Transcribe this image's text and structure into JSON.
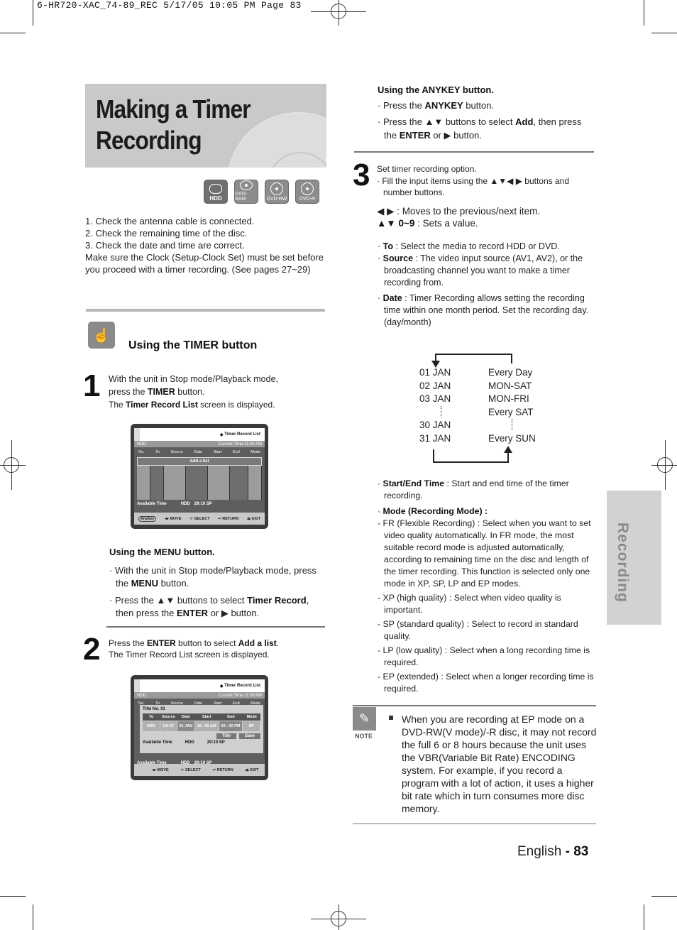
{
  "slug": "6-HR720-XAC_74-89_REC   5/17/05   10:05 PM   Page 83",
  "title": {
    "line1": "Making a Timer",
    "line2": "Recording"
  },
  "media_icons": [
    {
      "label": "HDD",
      "icon": "hdd-icon"
    },
    {
      "label": "DVD-RAM",
      "icon": "disc-icon"
    },
    {
      "label": "DVD-RW",
      "icon": "disc-icon"
    },
    {
      "label": "DVD-R",
      "icon": "disc-icon"
    }
  ],
  "intro": [
    "1. Check the antenna cable is connected.",
    "2. Check the remaining time of the disc.",
    "3. Check the date and time are correct.",
    "Make sure the Clock (Setup-Clock Set) must be set before you proceed with a timer recording. (See pages 27~29)"
  ],
  "section_title": "Using the TIMER button",
  "step1": {
    "number": "1",
    "line1": "With the unit in Stop mode/Playback mode,",
    "line2_pre": "press the ",
    "line2_bold": "TIMER",
    "line2_post": " button.",
    "line3_pre": "The ",
    "line3_bold": "Timer Record List",
    "line3_post": " screen is displayed."
  },
  "osd1": {
    "header": "Timer Record List",
    "media": "HDD",
    "current_time": "Current Time 11:00 AM",
    "columns": [
      "No.",
      "To",
      "Source",
      "Date",
      "Start",
      "End",
      "Mode"
    ],
    "add_label": "Add a list",
    "available_label": "Available Time",
    "available_media": "HDD",
    "available_value": "29:10  SP",
    "footer": [
      "Anykey",
      "MOVE",
      "SELECT",
      "RETURN",
      "EXIT"
    ]
  },
  "menu_method": {
    "heading": "Using the MENU button.",
    "b1_pre": "With the unit in Stop mode/Playback mode, press the ",
    "b1_bold": "MENU",
    "b1_post": " button.",
    "b2_pre": "Press the ▲▼ buttons to select ",
    "b2_bold": "Timer Record",
    "b2_mid": ", then press the ",
    "b2_bold2": "ENTER",
    "b2_post": " or ▶ button."
  },
  "step2": {
    "number": "2",
    "line1_pre": "Press the ",
    "line1_bold": "ENTER",
    "line1_mid": " button to select ",
    "line1_bold2": "Add a list",
    "line1_post": ".",
    "line2": "The Timer Record List screen is displayed."
  },
  "osd2": {
    "header": "Timer Record List",
    "media": "HDD",
    "current_time": "Current Time 11:00 AM",
    "columns": [
      "No.",
      "To",
      "Source",
      "Date",
      "Start",
      "End",
      "Mode"
    ],
    "popup_title": "Title No. 01",
    "popup_columns": [
      "To",
      "Source",
      "Date",
      "Start",
      "End",
      "Mode"
    ],
    "popup_values": [
      "HDD",
      "CH 07",
      "01 JAN",
      "11 : 00 AM",
      "02 : 00 PM",
      "SP"
    ],
    "buttons": [
      "Title",
      "Save"
    ],
    "available_label": "Available Time",
    "available_media": "HDD",
    "available_value": "29:10  SP",
    "footer": [
      "MOVE",
      "SELECT",
      "RETURN",
      "EXIT"
    ]
  },
  "anykey_method": {
    "heading": "Using the ANYKEY button.",
    "b1_pre": "Press the ",
    "b1_bold": "ANYKEY",
    "b1_post": " button.",
    "b2_pre": "Press the ▲▼ buttons to select ",
    "b2_bold": "Add",
    "b2_mid": ", then press the ",
    "b2_bold2": "ENTER",
    "b2_post": " or ▶ button."
  },
  "step3": {
    "number": "3",
    "line1": "Set timer recording option.",
    "line2": "· Fill the input items using the ▲▼◀ ▶ buttons and number buttons.",
    "nav1": "◀ ▶ : Moves to the previous/next item.",
    "nav2_bold": "▲▼ 0~9",
    "nav2_post": " : Sets a value."
  },
  "fields": [
    {
      "name": "To",
      "desc": " : Select the media to record HDD or DVD."
    },
    {
      "name": "Source",
      "desc": " : The video input source (AV1, AV2), or the broadcasting channel you want to make a timer recording from."
    },
    {
      "name": "Date",
      "desc": " : Timer Recording allows setting the recording time within one month period. Set the recording day. (day/month)"
    }
  ],
  "date_cycle": {
    "days": [
      "01 JAN",
      "02 JAN",
      "03 JAN",
      "30 JAN",
      "31 JAN"
    ],
    "repeats": [
      "Every Day",
      "MON-SAT",
      "MON-FRI",
      "Every SAT",
      "Every SUN"
    ]
  },
  "fields2": [
    {
      "name": "Start/End Time",
      "desc": " : Start and end time of the timer recording."
    },
    {
      "name": "Mode (Recording Mode) :",
      "desc": ""
    }
  ],
  "modes": [
    "- FR (Flexible Recording) : Select when you want to set video quality automatically. In FR mode, the most suitable record mode is adjusted automatically, according to remaining time on the disc and length of the timer recording. This function is selected only one mode in XP, SP, LP and EP modes.",
    "- XP (high quality) : Select when video quality is important.",
    "- SP (standard quality) : Select to record in standard quality.",
    "- LP (low quality) : Select when a long recording time is required.",
    "- EP (extended) : Select when a longer recording time is required."
  ],
  "note": {
    "label": "NOTE",
    "text": "When you are recording at EP mode on a DVD-RW(V mode)/-R disc, it may not record the full 6 or 8 hours because the unit uses the VBR(Variable Bit Rate) ENCODING system. For example, if you record a program with a lot of action, it uses a higher bit rate which in turn consumes more disc memory."
  },
  "side_tab": "Recording",
  "footer": {
    "lang": "English",
    "sep": " - ",
    "page": "83"
  }
}
